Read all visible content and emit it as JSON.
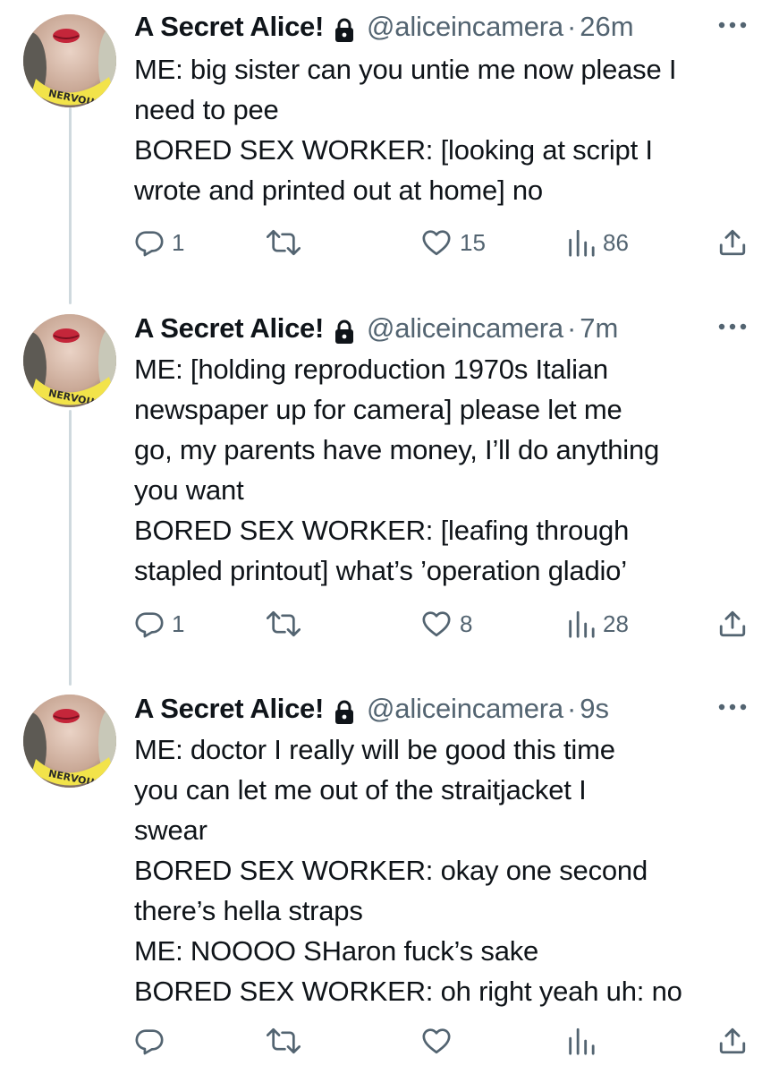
{
  "tweets": [
    {
      "display_name": "A Secret Alice!",
      "handle": "@aliceincamera",
      "separator": "·",
      "time": "26m",
      "lines": [
        "ME: big sister can you untie me now please I",
        "need to pee",
        "BORED SEX WORKER: [looking at script I",
        "wrote and printed out at home] no"
      ],
      "replies": "1",
      "retweets": "",
      "likes": "15",
      "views": "86"
    },
    {
      "display_name": "A Secret Alice!",
      "handle": "@aliceincamera",
      "separator": "·",
      "time": "7m",
      "lines": [
        "ME: [holding reproduction 1970s Italian",
        "newspaper up for camera] please let me",
        "go, my parents have money, I’ll do anything",
        "you want",
        "BORED SEX WORKER: [leafing through",
        "stapled printout] what’s ’operation gladio’"
      ],
      "replies": "1",
      "retweets": "",
      "likes": "8",
      "views": "28"
    },
    {
      "display_name": "A Secret Alice!",
      "handle": "@aliceincamera",
      "separator": "·",
      "time": "9s",
      "lines": [
        "ME: doctor I really will be good this time",
        "you can let me out of the straitjacket I",
        "swear",
        "BORED SEX WORKER: okay one second",
        "there’s hella straps",
        "ME: NOOOO SHaron fuck’s sake",
        "BORED SEX WORKER: oh right yeah uh: no"
      ],
      "replies": "",
      "retweets": "",
      "likes": "",
      "views": ""
    }
  ],
  "avatar_collar_text": "NERVOUS",
  "colors": {
    "text": "#0f1419",
    "secondary": "#536471",
    "thread_line": "#cfd9de",
    "collar": "#f2e34a"
  },
  "icons": {
    "lock": "lock-icon",
    "more": "more-icon",
    "reply": "reply-icon",
    "retweet": "retweet-icon",
    "like": "heart-icon",
    "views": "views-icon",
    "share": "share-icon"
  }
}
